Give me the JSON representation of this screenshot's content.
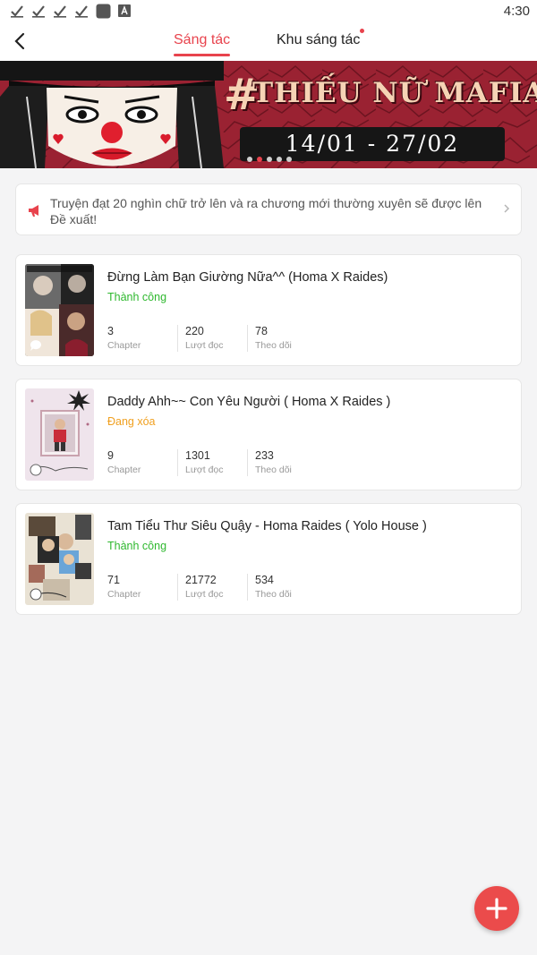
{
  "status_bar": {
    "time": "4:30",
    "icons": [
      "check-icon",
      "check-icon",
      "check-icon",
      "check-icon",
      "square-icon",
      "font-icon"
    ]
  },
  "nav": {
    "back_icon": "back-arrow-icon",
    "tabs": [
      {
        "label": "Sáng tác",
        "active": true
      },
      {
        "label": "Khu sáng tác",
        "active": false,
        "has_dot": true
      }
    ]
  },
  "banner": {
    "hash": "#",
    "title": "THIẾU NỮ MAFIA",
    "date_range": "14/01 - 27/02",
    "slides": 5,
    "active_slide": 2
  },
  "notice": {
    "icon": "megaphone-icon",
    "text": "Truyện đạt 20 nghìn chữ trở lên và ra chương mới thường xuyên sẽ được lên Đề xuất!"
  },
  "stories": [
    {
      "title": "Đừng Làm Bạn Giường Nữa^^ (Homa X Raides)",
      "status": "Thành công",
      "status_type": "ok",
      "chapters": "3",
      "chapters_label": "Chapter",
      "reads": "220",
      "reads_label": "Lượt đọc",
      "follows": "78",
      "follows_label": "Theo dõi"
    },
    {
      "title": "Daddy Ahh~~ Con Yêu Người ( Homa X Raides )",
      "status": "Đang xóa",
      "status_type": "pending",
      "chapters": "9",
      "chapters_label": "Chapter",
      "reads": "1301",
      "reads_label": "Lượt đọc",
      "follows": "233",
      "follows_label": "Theo dõi"
    },
    {
      "title": "Tam Tiểu Thư Siêu Quậy - Homa Raides ( Yolo House )",
      "status": "Thành công",
      "status_type": "ok",
      "chapters": "71",
      "chapters_label": "Chapter",
      "reads": "21772",
      "reads_label": "Lượt đọc",
      "follows": "534",
      "follows_label": "Theo dõi"
    }
  ],
  "fab": {
    "icon": "plus-icon"
  },
  "colors": {
    "accent": "#e8434d",
    "success": "#2eb82e",
    "warning": "#f0a020",
    "fab": "#eb4b4b"
  }
}
